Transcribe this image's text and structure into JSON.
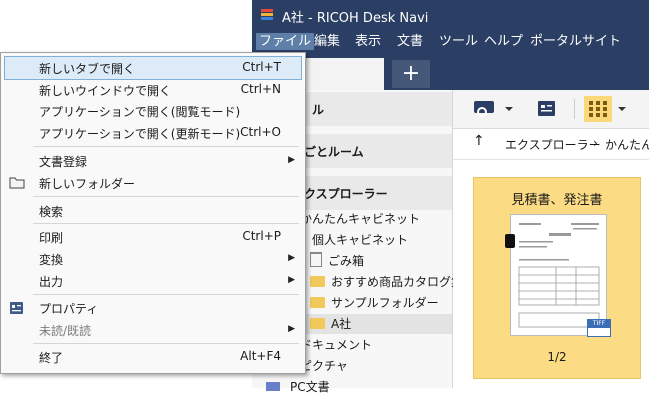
{
  "window": {
    "title": "A社 - RICOH Desk Navi"
  },
  "menubar": {
    "items": [
      "ファイル",
      "編集",
      "表示",
      "文書",
      "ツール",
      "ヘルプ",
      "ポータルサイト"
    ]
  },
  "tabs": {
    "add_label": "+"
  },
  "left_pane": {
    "sections": [
      "ル",
      "ごとルーム",
      "クスプローラー"
    ],
    "tree": [
      "かんたんキャビネット",
      "個人キャビネット",
      "ごみ箱",
      "おすすめ商品カタログ集",
      "サンプルフォルダー",
      "A社",
      "ドキュメント",
      "ピクチャ",
      "PC文書"
    ]
  },
  "right_pane": {
    "breadcrumb": [
      "エクスプローラー",
      "かんたん"
    ],
    "document": {
      "title": "見積書、発注書",
      "page_count": "1/2",
      "format_badge": "TIFF"
    }
  },
  "context_menu": {
    "items": [
      {
        "label": "新しいタブで開く",
        "shortcut": "Ctrl+T"
      },
      {
        "label": "新しいウインドウで開く",
        "shortcut": "Ctrl+N"
      },
      {
        "label": "アプリケーションで開く(閲覧モード)",
        "shortcut": ""
      },
      {
        "label": "アプリケーションで開く(更新モード)",
        "shortcut": "Ctrl+O"
      },
      {
        "label": "文書登録",
        "shortcut": ""
      },
      {
        "label": "新しいフォルダー",
        "shortcut": ""
      },
      {
        "label": "検索",
        "shortcut": ""
      },
      {
        "label": "印刷",
        "shortcut": "Ctrl+P"
      },
      {
        "label": "変換",
        "shortcut": ""
      },
      {
        "label": "出力",
        "shortcut": ""
      },
      {
        "label": "プロパティ",
        "shortcut": ""
      },
      {
        "label": "未読/既読",
        "shortcut": ""
      },
      {
        "label": "終了",
        "shortcut": "Alt+F4"
      }
    ]
  },
  "colors": {
    "titlebar": "#2b3e63",
    "highlight": "#dcebf7",
    "doc_card": "#fbdb83",
    "folder": "#f0c95a"
  }
}
